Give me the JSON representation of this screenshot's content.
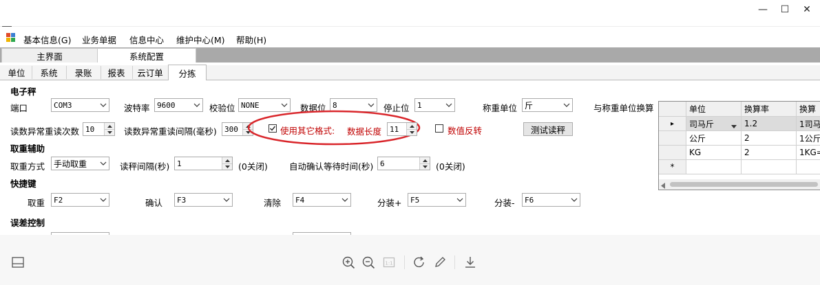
{
  "window": {
    "minimize": "—",
    "maximize": "☐",
    "close": "✕"
  },
  "menu": {
    "items": [
      "基本信息(G)",
      "业务单据",
      "信息中心",
      "维护中心(M)",
      "帮助(H)"
    ]
  },
  "main_tabs": [
    "主界面",
    "系统配置"
  ],
  "sub_tabs": [
    "单位",
    "系统",
    "录账",
    "报表",
    "云订单",
    "分拣"
  ],
  "scale": {
    "section": "电子秤",
    "port_label": "端口",
    "port_value": "COM3",
    "baud_label": "波特率",
    "baud_value": "9600",
    "parity_label": "校验位",
    "parity_value": "NONE",
    "databits_label": "数据位",
    "databits_value": "8",
    "stopbits_label": "停止位",
    "stopbits_value": "1",
    "unit_label": "称重单位",
    "unit_value": "斤",
    "convert_label": "与称重单位换算",
    "retry_count_label": "读数异常重读次数",
    "retry_count_value": "10",
    "retry_interval_label": "读数异常重读间隔(毫秒)",
    "retry_interval_value": "300",
    "other_format_label": "使用其它格式:",
    "other_format_checked": true,
    "data_length_label": "数据长度",
    "data_length_value": "11",
    "invert_label": "数值反转",
    "invert_checked": false,
    "test_button": "测试读秤"
  },
  "weigh_assist": {
    "section": "取重辅助",
    "mode_label": "取重方式",
    "mode_value": "手动取重",
    "interval_label": "读秤间隔(秒)",
    "interval_value": "1",
    "interval_note": "(0关闭)",
    "auto_confirm_label": "自动确认等待时间(秒)",
    "auto_confirm_value": "6",
    "auto_confirm_note": "(0关闭)"
  },
  "shortcuts": {
    "section": "快捷键",
    "items": [
      {
        "label": "取重",
        "value": "F2"
      },
      {
        "label": "确认",
        "value": "F3"
      },
      {
        "label": "清除",
        "value": "F4"
      },
      {
        "label": "分装+",
        "value": "F5"
      },
      {
        "label": "分装-",
        "value": "F6"
      }
    ]
  },
  "error_control": {
    "section": "误差控制"
  },
  "grid": {
    "headers": [
      "单位",
      "换算率",
      "换算"
    ],
    "rows": [
      {
        "unit": "司马斤",
        "rate": "1.2",
        "convert": "1司马"
      },
      {
        "unit": "公斤",
        "rate": "2",
        "convert": "1公斤"
      },
      {
        "unit": "KG",
        "rate": "2",
        "convert": "1KG="
      }
    ],
    "current_row_marker": "▸",
    "new_row_marker": "*"
  },
  "toolbar": {
    "icons": [
      "zoom-in-icon",
      "zoom-out-icon",
      "fit-page-icon",
      "rotate-icon",
      "edit-icon",
      "download-icon"
    ]
  },
  "colors": {
    "accent_red": "#c00000",
    "tab_strip": "#a9a9a9",
    "highlight_circle": "#d9262b"
  }
}
